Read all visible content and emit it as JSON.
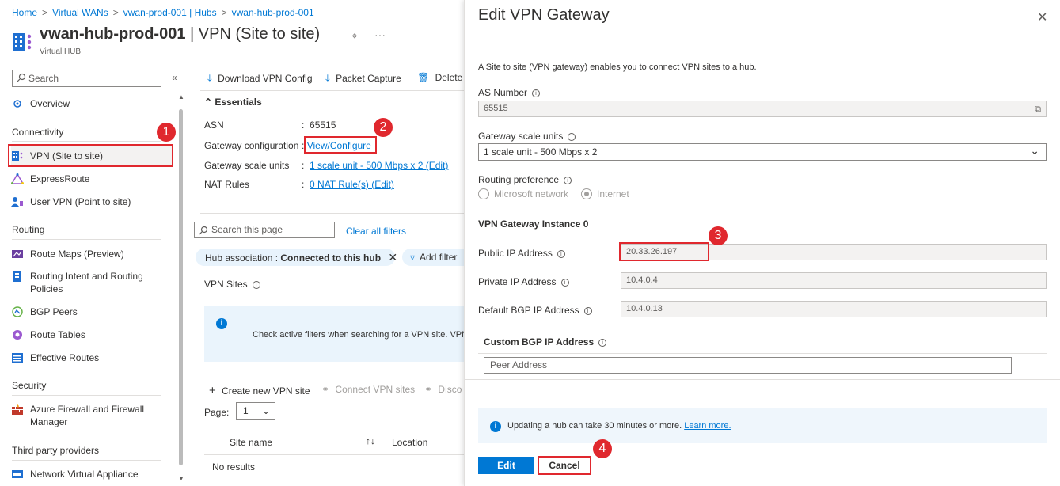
{
  "breadcrumb": [
    "Home",
    "Virtual WANs",
    "vwan-prod-001 | Hubs",
    "vwan-hub-prod-001"
  ],
  "header": {
    "title_bold": "vwan-hub-prod-001",
    "title_rest": " | VPN (Site to site)",
    "subtitle": "Virtual HUB"
  },
  "sidebar": {
    "search_placeholder": "Search",
    "overview": "Overview",
    "sections": {
      "connectivity": "Connectivity",
      "routing": "Routing",
      "security": "Security",
      "third_party": "Third party providers"
    },
    "items": {
      "vpn": "VPN (Site to site)",
      "expressroute": "ExpressRoute",
      "user_vpn": "User VPN (Point to site)",
      "route_maps": "Route Maps (Preview)",
      "routing_intent_1": "Routing Intent and Routing",
      "routing_intent_2": "Policies",
      "bgp_peers": "BGP Peers",
      "route_tables": "Route Tables",
      "effective_routes": "Effective Routes",
      "firewall_1": "Azure Firewall and Firewall",
      "firewall_2": "Manager",
      "nva": "Network Virtual Appliance"
    }
  },
  "toolbar": {
    "download": "Download VPN Config",
    "capture": "Packet Capture",
    "delete": "Delete g"
  },
  "essentials": {
    "header": "Essentials",
    "asn_label": "ASN",
    "asn_value": "65515",
    "gw_config_label": "Gateway configuration",
    "gw_config_value": "View/Configure",
    "scale_label": "Gateway scale units",
    "scale_value": "1 scale unit - 500 Mbps x 2 (Edit)",
    "nat_label": "NAT Rules",
    "nat_value": "0 NAT Rule(s) (Edit)",
    "sep": ":"
  },
  "filters": {
    "search_placeholder": "Search this page",
    "clear": "Clear all filters",
    "pill_key": "Hub association : ",
    "pill_value": "Connected to this hub",
    "add_filter": "Add filter"
  },
  "vpn_sites": {
    "label": "VPN Sites",
    "info_text": "Check active filters when searching for a VPN site. VPN c",
    "create": "Create new VPN site",
    "connect": "Connect VPN sites",
    "disconnect": "Disco",
    "page_label": "Page:",
    "page_value": "1",
    "col_site": "Site name",
    "col_location": "Location",
    "no_results": "No results"
  },
  "panel": {
    "title": "Edit VPN Gateway",
    "description": "A Site to site (VPN gateway) enables you to connect VPN sites to a hub.",
    "as_number_label": "AS Number",
    "as_number_value": "65515",
    "scale_label": "Gateway scale units",
    "scale_value": "1 scale unit - 500 Mbps x 2",
    "routing_pref_label": "Routing preference",
    "routing_option_1": "Microsoft network",
    "routing_option_2": "Internet",
    "instance_header": "VPN Gateway Instance 0",
    "public_ip_label": "Public IP Address",
    "public_ip_value": "20.33.26.197",
    "private_ip_label": "Private IP Address",
    "private_ip_value": "10.4.0.4",
    "default_bgp_label": "Default BGP IP Address",
    "default_bgp_value": "10.4.0.13",
    "custom_bgp_label": "Custom BGP IP Address",
    "peer_placeholder": "Peer Address",
    "info_text": "Updating a hub can take 30 minutes or more.",
    "learn_more": "Learn more.",
    "edit_button": "Edit",
    "cancel_button": "Cancel"
  },
  "callouts": [
    "1",
    "2",
    "3",
    "4"
  ]
}
